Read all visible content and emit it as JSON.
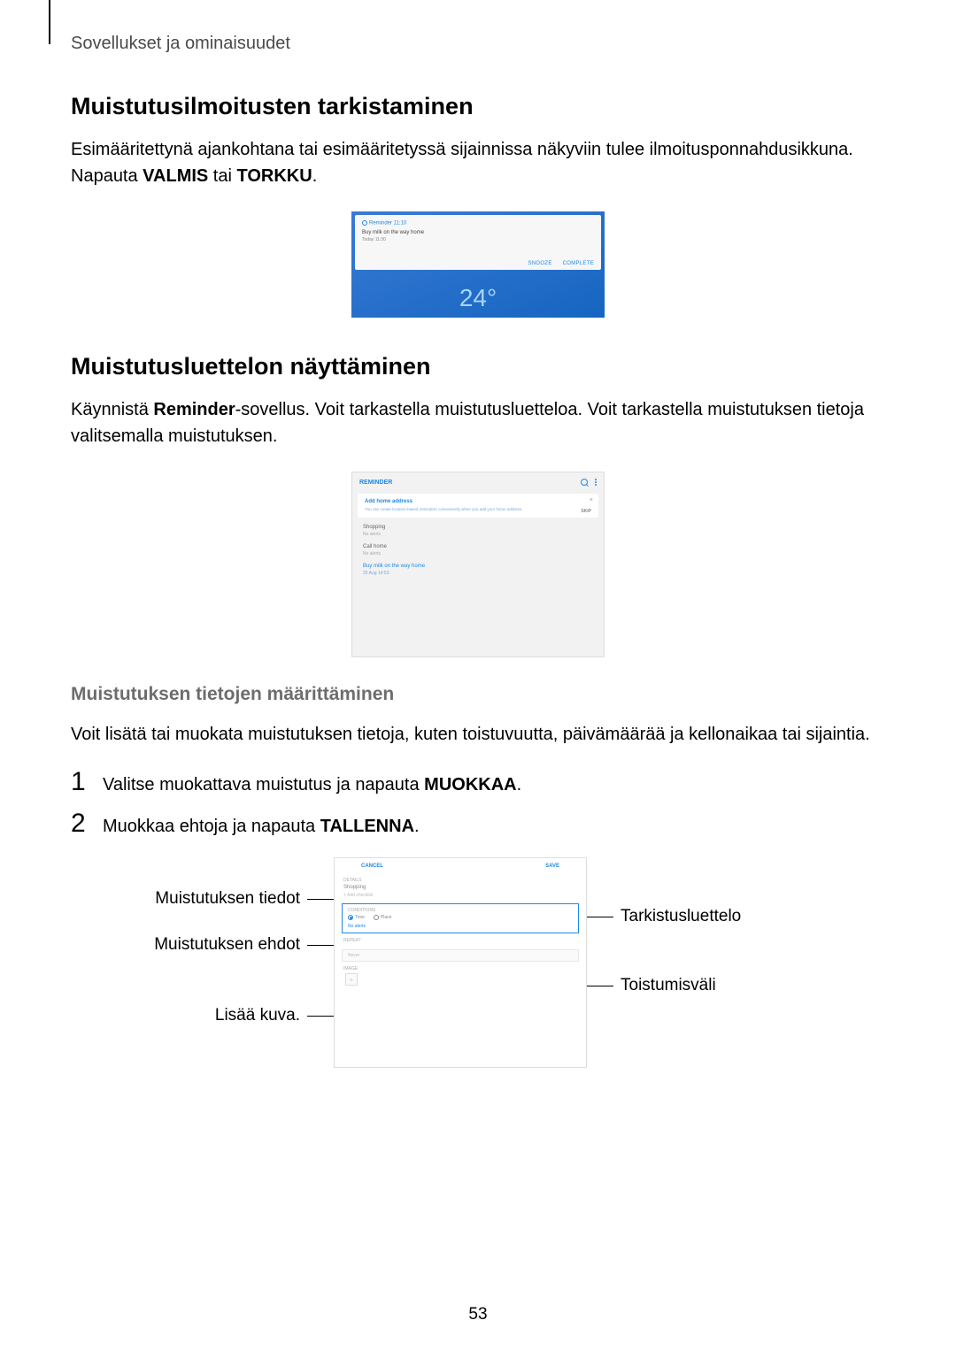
{
  "header": {
    "breadcrumb": "Sovellukset ja ominaisuudet"
  },
  "section1": {
    "heading": "Muistutusilmoitusten tarkistaminen",
    "para_pre": "Esimääritettynä ajankohtana tai esimääritetyssä sijainnissa näkyviin tulee ilmoitusponnahdusikkuna. Napauta ",
    "bold1": "VALMIS",
    "mid": " tai ",
    "bold2": "TORKKU",
    "end": ".",
    "shot": {
      "app": "Reminder  11:10",
      "title": "Buy milk on the way home",
      "sub": "Today 11:30",
      "btn1": "SNOOZE",
      "btn2": "COMPLETE",
      "temp": "24°"
    }
  },
  "section2": {
    "heading": "Muistutusluettelon näyttäminen",
    "para_pre": "Käynnistä ",
    "bold1": "Reminder",
    "para_post": "-sovellus. Voit tarkastella muistutusluetteloa. Voit tarkastella muistutuksen tietoja valitsemalla muistutuksen.",
    "shot": {
      "title": "REMINDER",
      "card_title": "Add home address",
      "card_desc": "You can create location-based reminders conveniently when you add your home address.",
      "card_skip": "SKIP",
      "items": [
        {
          "t": "Shopping",
          "s": "No alerts"
        },
        {
          "t": "Call home",
          "s": "No alerts"
        },
        {
          "t": "Buy milk on the way home",
          "s": "25 Aug 14:53",
          "blue": true
        }
      ]
    }
  },
  "section3": {
    "heading": "Muistutuksen tietojen määrittäminen",
    "para": "Voit lisätä tai muokata muistutuksen tietoja, kuten toistuvuutta, päivämäärää ja kellonaikaa tai sijaintia.",
    "step1_pre": "Valitse muokattava muistutus ja napauta ",
    "step1_bold": "MUOKKAA",
    "step1_end": ".",
    "step2_pre": "Muokkaa ehtoja ja napauta ",
    "step2_bold": "TALLENNA",
    "step2_end": ".",
    "shot": {
      "cancel": "CANCEL",
      "save": "SAVE",
      "details_label": "DETAILS",
      "details_val": "Shopping",
      "details_add": "+  Add checklist",
      "cond_label": "CONDITIONS",
      "radio_time": "Time",
      "radio_place": "Place",
      "noalert": "No alerts",
      "repeat_label": "REPEAT",
      "repeat_val": "Never",
      "image_label": "IMAGE"
    },
    "callouts": {
      "c1": "Muistutuksen tiedot",
      "c2": "Muistutuksen ehdot",
      "c3": "Lisää kuva.",
      "c4": "Tarkistusluettelo",
      "c5": "Toistumisväli"
    }
  },
  "pagenum": "53"
}
